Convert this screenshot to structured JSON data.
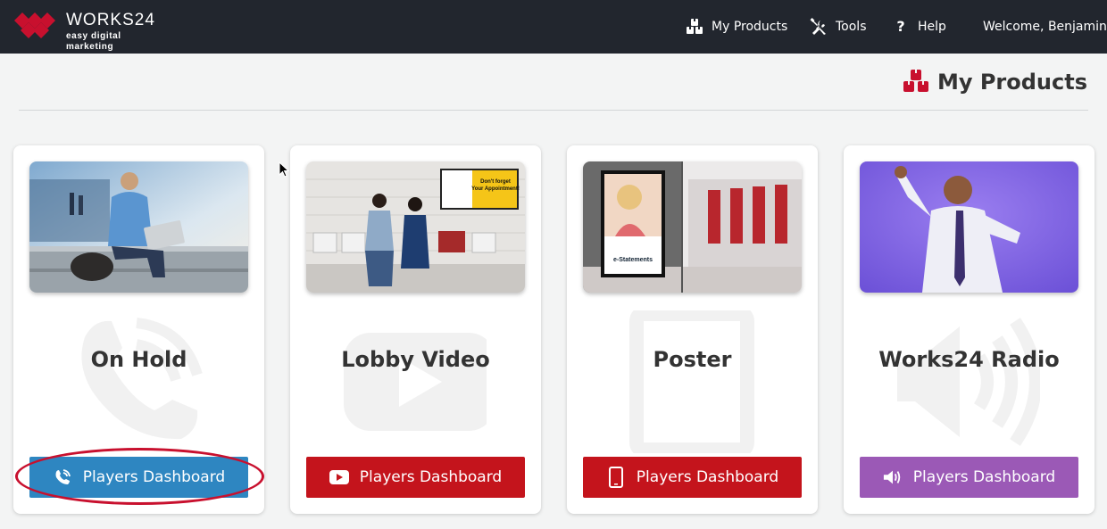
{
  "brand": {
    "name": "WORKS24",
    "tagline": "easy digital marketing",
    "logo_color": "#c8102e"
  },
  "nav": {
    "items": [
      {
        "label": "My Products",
        "icon": "boxes-icon"
      },
      {
        "label": "Tools",
        "icon": "tools-icon"
      },
      {
        "label": "Help",
        "icon": "question-icon"
      }
    ],
    "welcome": "Welcome, Benjamin"
  },
  "page": {
    "title": "My Products",
    "title_icon": "boxes-icon"
  },
  "cards": [
    {
      "title": "On Hold",
      "button": "Players Dashboard",
      "button_color": "#2e86c1",
      "button_icon": "phone-icon",
      "watermark_icon": "phone-icon",
      "highlighted": true
    },
    {
      "title": "Lobby Video",
      "button": "Players Dashboard",
      "button_color": "#c4141c",
      "button_icon": "youtube-icon",
      "watermark_icon": "youtube-icon"
    },
    {
      "title": "Poster",
      "button": "Players Dashboard",
      "button_color": "#c4141c",
      "button_icon": "tablet-icon",
      "watermark_icon": "tablet-icon"
    },
    {
      "title": "Works24 Radio",
      "button": "Players Dashboard",
      "button_color": "#9b59b6",
      "button_icon": "speaker-icon",
      "watermark_icon": "speaker-icon"
    }
  ],
  "poster_sign": {
    "line1": "Don't forget",
    "line2": "Your Appointment!",
    "headline": "e-Statements"
  }
}
